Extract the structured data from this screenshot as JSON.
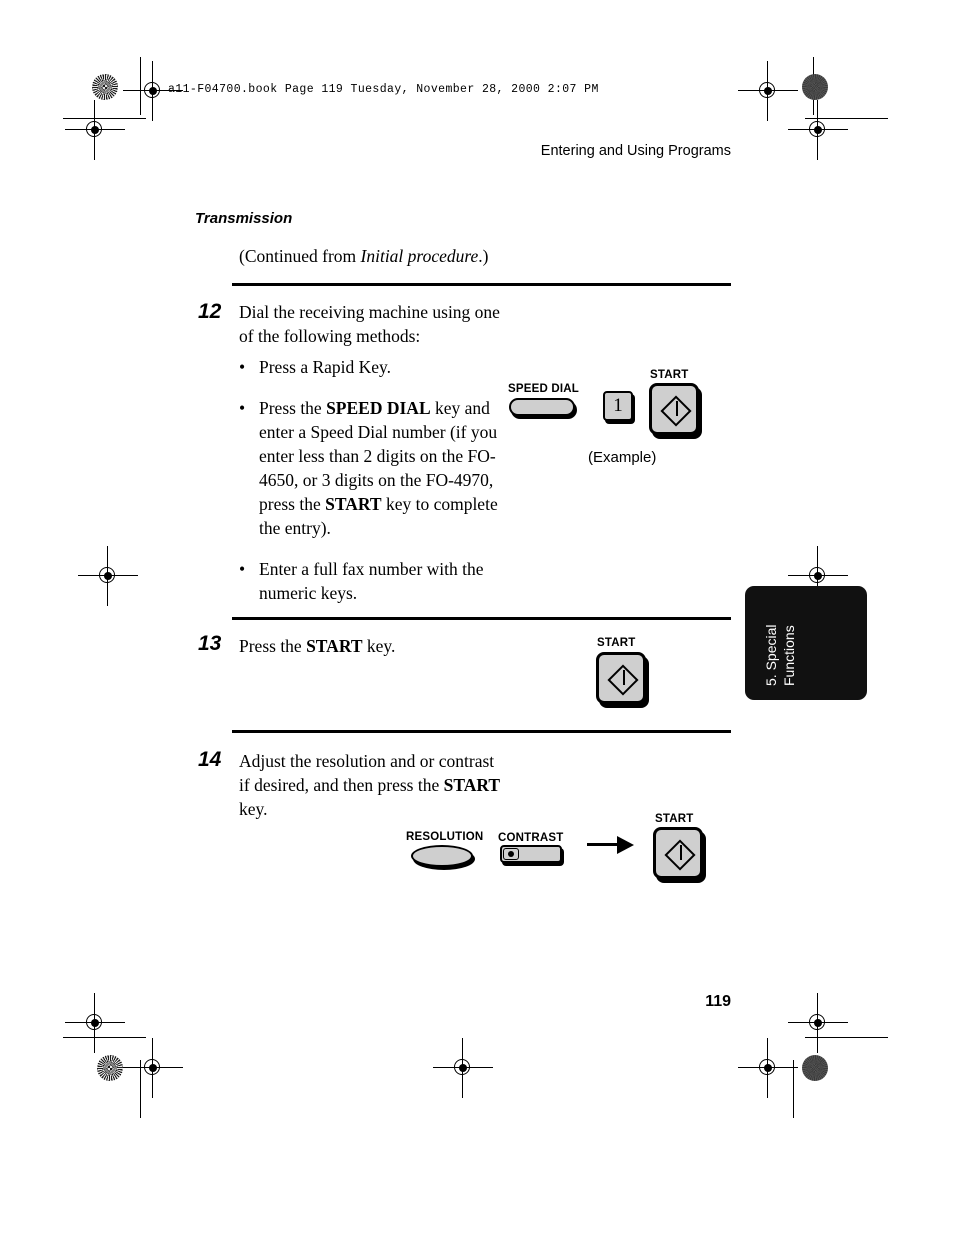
{
  "book_header": "a11-F04700.book  Page 119  Tuesday, November 28, 2000  2:07 PM",
  "running_head": "Entering and Using Programs",
  "section": {
    "title": "Transmission",
    "continued_prefix": "(Continued from ",
    "continued_italic": "Initial procedure",
    "continued_suffix": ".)"
  },
  "steps": [
    {
      "number": "12",
      "line1": "Dial the receiving machine using one",
      "line2": "of the following methods:",
      "bullets": [
        "Press a Rapid Key.",
        "Press the SPEED DIAL key and enter a Speed Dial number (if you enter less than 2 digits on the FO-4650, or 3 digits on the FO-4970, press the START key to complete the entry).",
        "Enter a full fax number with the numeric keys."
      ]
    },
    {
      "number": "13",
      "line1": "Press the START key."
    },
    {
      "number": "14",
      "line1": "Adjust the resolution and or contrast",
      "line2": "if desired, and then press the START",
      "line3": "key."
    }
  ],
  "keys": {
    "speed_dial_label": "SPEED DIAL",
    "numeric_key_value": "1",
    "start_label": "START",
    "example_caption": "(Example)",
    "resolution_label": "RESOLUTION",
    "contrast_label": "CONTRAST",
    "contrast_glyph": "contrast-magnifier-icon",
    "start_glyph": "start-diamond-icon",
    "arrow_glyph": "right-arrow-icon",
    "key_face_color": "#cfcfcf",
    "key_outline_color": "#000000"
  },
  "side_tab": {
    "line1": "5. Special",
    "line2": "Functions",
    "background": "#111111",
    "text_color": "#ffffff"
  },
  "folio": "119"
}
